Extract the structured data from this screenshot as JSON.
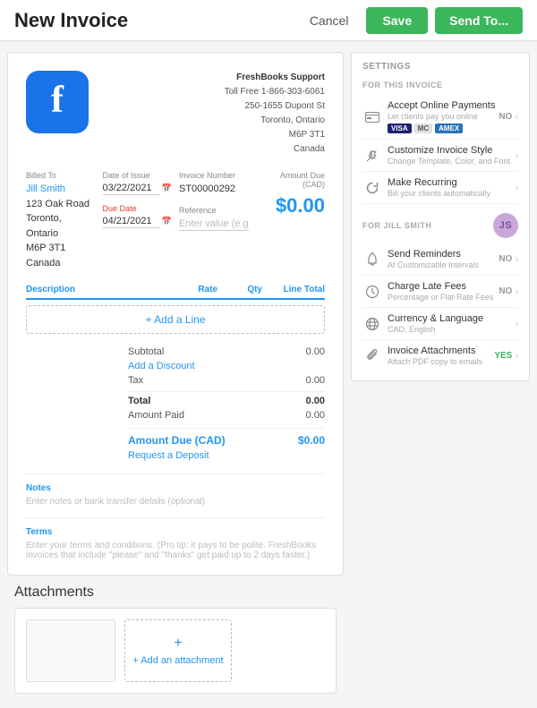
{
  "header": {
    "title": "New Invoice",
    "cancel_label": "Cancel",
    "save_label": "Save",
    "sendto_label": "Send To..."
  },
  "invoice": {
    "company": {
      "name": "FreshBooks Support",
      "phone_label": "Toll Free",
      "phone": "1-866-303-6061",
      "address_line1": "250-1655 Dupont St",
      "address_line2": "Toronto, Ontario",
      "address_line3": "M6P 3T1",
      "address_line4": "Canada"
    },
    "billed_to_label": "Billed To",
    "client_name": "Jill Smith",
    "client_address1": "123 Oak Road",
    "client_city": "Toronto, Ontario",
    "client_postal": "M6P 3T1",
    "client_country": "Canada",
    "date_of_issue_label": "Date of Issue",
    "date_of_issue": "03/22/2021",
    "invoice_number_label": "Invoice Number",
    "invoice_number": "ST00000292",
    "amount_due_label": "Amount Due (CAD)",
    "amount_due": "$0.00",
    "due_date_label": "Due Date",
    "due_date": "04/21/2021",
    "reference_label": "Reference",
    "reference_placeholder": "Enter value (e.g. PO #)",
    "line_items": {
      "description_col": "Description",
      "rate_col": "Rate",
      "qty_col": "Qty",
      "line_total_col": "Line Total",
      "add_line_label": "+ Add a Line"
    },
    "totals": {
      "subtotal_label": "Subtotal",
      "subtotal_val": "0.00",
      "discount_label": "Add a Discount",
      "tax_label": "Tax",
      "tax_val": "0.00",
      "total_label": "Total",
      "total_val": "0.00",
      "amount_paid_label": "Amount Paid",
      "amount_paid_val": "0.00",
      "amount_due_label": "Amount Due (CAD)",
      "amount_due_val": "$0.00",
      "deposit_label": "Request a Deposit"
    },
    "notes_label": "Notes",
    "notes_placeholder": "Enter notes or bank transfer details (optional)",
    "terms_label": "Terms",
    "terms_placeholder": "Enter your terms and conditions. (Pro tip: it pays to be polite. FreshBooks invoices that include \"please\" and \"thanks\" get paid up to 2 days faster.)"
  },
  "settings": {
    "section_title": "Settings",
    "for_invoice_title": "FOR THIS INVOICE",
    "items": [
      {
        "id": "accept-online-payments",
        "title": "Accept Online Payments",
        "subtitle": "Let clients pay you online",
        "toggle": "NO",
        "show_cards": true
      },
      {
        "id": "customize-invoice-style",
        "title": "Customize Invoice Style",
        "subtitle": "Change Template, Color, and Font",
        "toggle": "",
        "show_cards": false
      },
      {
        "id": "make-recurring",
        "title": "Make Recurring",
        "subtitle": "Bill your clients automatically",
        "toggle": "",
        "show_cards": false
      }
    ],
    "for_user_title": "FOR JILL SMITH",
    "user_initials": "JS",
    "user_items": [
      {
        "id": "send-reminders",
        "title": "Send Reminders",
        "subtitle": "At Customizable Intervals",
        "toggle": "NO"
      },
      {
        "id": "charge-late-fees",
        "title": "Charge Late Fees",
        "subtitle": "Percentage or Flat-Rate Fees",
        "toggle": "NO"
      },
      {
        "id": "currency-language",
        "title": "Currency & Language",
        "subtitle": "CAD, English",
        "toggle": ""
      },
      {
        "id": "invoice-attachments",
        "title": "Invoice Attachments",
        "subtitle": "Attach PDF copy to emails",
        "toggle": "YES"
      }
    ]
  },
  "attachments": {
    "title": "Attachments",
    "add_label": "+ Add an attachment"
  },
  "icons": {
    "credit_card": "💳",
    "wand": "✨",
    "refresh": "↺",
    "bell": "🔔",
    "clock": "⏱",
    "globe": "🌐",
    "paperclip": "📎",
    "calendar": "📅",
    "chevron": "›"
  }
}
